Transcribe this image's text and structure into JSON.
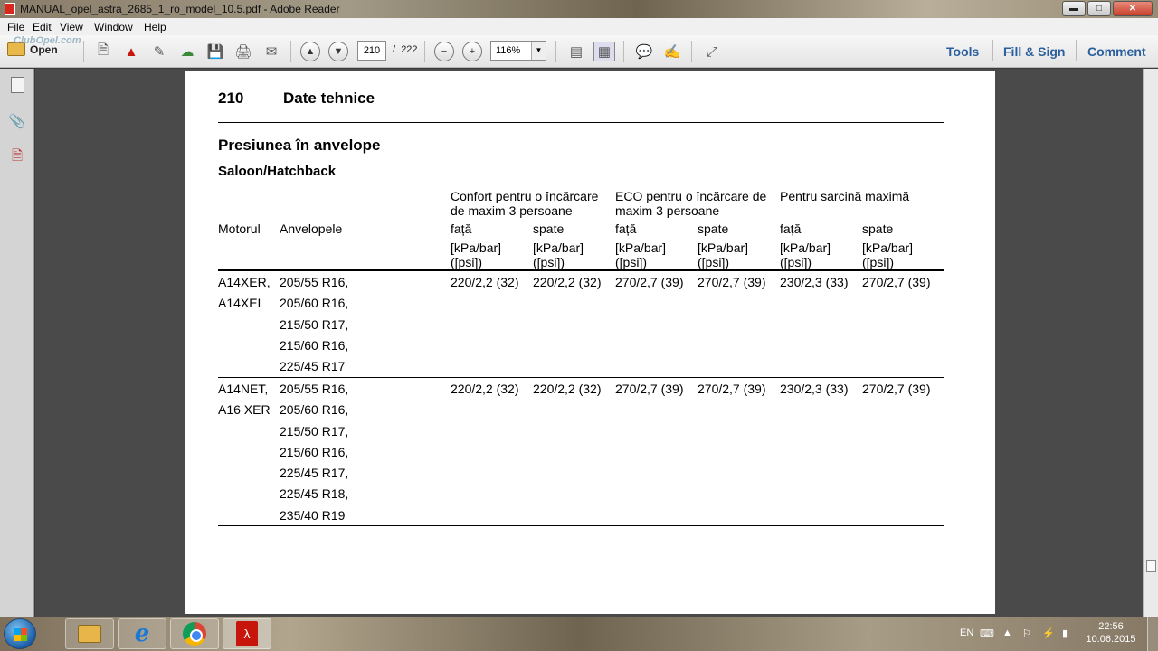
{
  "window": {
    "title": "MANUAL_opel_astra_2685_1_ro_model_10.5.pdf - Adobe Reader",
    "controls": [
      "minimize",
      "maximize",
      "close"
    ]
  },
  "watermark": "ClubOpel.com",
  "menu": [
    "File",
    "Edit",
    "View",
    "Window",
    "Help"
  ],
  "toolbar": {
    "open_label": "Open",
    "page_current": "210",
    "page_separator": "/",
    "page_total": "222",
    "zoom": "116%",
    "right_tools": [
      "Tools",
      "Fill & Sign",
      "Comment"
    ]
  },
  "icons": {
    "toolbar": [
      "create-pdf-icon",
      "acrobat-icon",
      "edit-icon",
      "cloud-upload-icon",
      "save-icon",
      "print-icon",
      "email-icon",
      "prev-page-icon",
      "next-page-icon",
      "zoom-out-icon",
      "zoom-in-icon",
      "fit-page-icon",
      "fit-width-icon",
      "comment-icon",
      "sign-icon",
      "fullscreen-icon"
    ],
    "nav": [
      "pages-panel-icon",
      "attachments-icon",
      "signatures-icon"
    ]
  },
  "document": {
    "page_number": "210",
    "page_header": "Date tehnice",
    "section_title": "Presiunea în anvelope",
    "subsection_title": "Saloon/Hatchback",
    "table": {
      "group_headers": [
        "Confort pentru o încărcare de maxim 3 persoane",
        "ECO pentru o încărcare de maxim 3 persoane",
        "Pentru sarcină maximă"
      ],
      "col_engine": "Motorul",
      "col_tyres": "Anvelopele",
      "sub_headers": [
        "față",
        "spate",
        "față",
        "spate",
        "față",
        "spate"
      ],
      "unit_line1": "[kPa/bar]",
      "unit_line2": "([psi])",
      "rows": [
        {
          "engines": [
            "A14XER,",
            "A14XEL"
          ],
          "tyres": [
            "205/55 R16,",
            "205/60 R16,",
            "215/50 R17,",
            "215/60 R16,",
            "225/45 R17"
          ],
          "values": [
            "220/2,2 (32)",
            "220/2,2 (32)",
            "270/2,7 (39)",
            "270/2,7 (39)",
            "230/2,3 (33)",
            "270/2,7 (39)"
          ]
        },
        {
          "engines": [
            "A14NET,",
            "A16 XER"
          ],
          "tyres": [
            "205/55 R16,",
            "205/60 R16,",
            "215/50 R17,",
            "215/60 R16,",
            "225/45 R17,",
            "225/45 R18,",
            "235/40 R19"
          ],
          "values": [
            "220/2,2 (32)",
            "220/2,2 (32)",
            "270/2,7 (39)",
            "270/2,7 (39)",
            "230/2,3 (33)",
            "270/2,7 (39)"
          ]
        }
      ]
    }
  },
  "taskbar": {
    "apps": [
      "windows-explorer",
      "internet-explorer",
      "chrome",
      "adobe-reader"
    ],
    "language": "EN",
    "time": "22:56",
    "date": "10.06.2015"
  }
}
